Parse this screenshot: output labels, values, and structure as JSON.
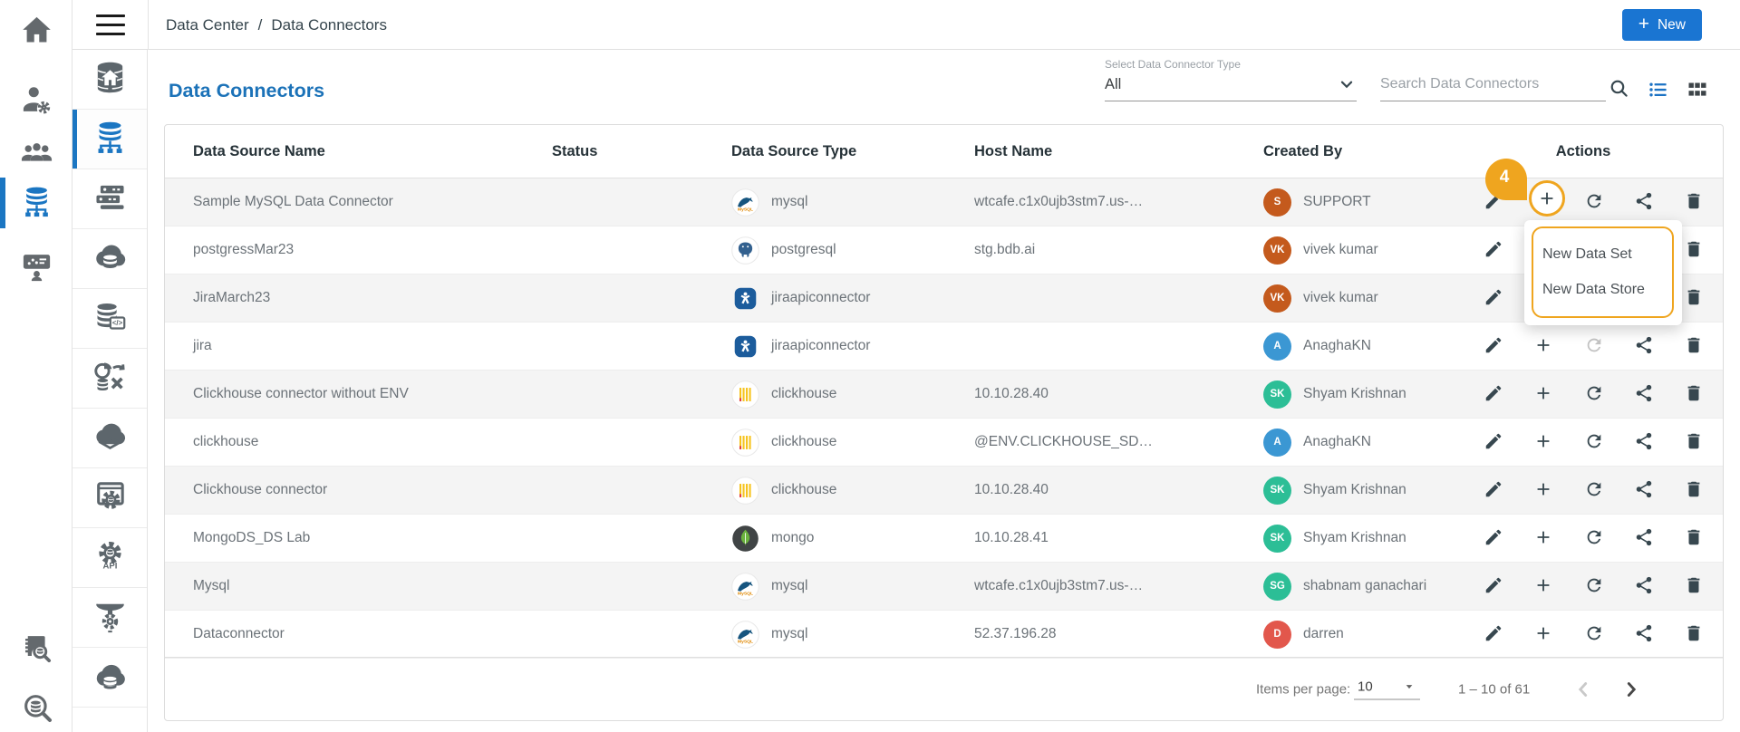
{
  "topbar": {
    "breadcrumb": [
      "Data Center",
      "Data Connectors"
    ],
    "breadcrumb_separator": "/",
    "new_button_label": "New",
    "new_button_plus": "+"
  },
  "page": {
    "title": "Data Connectors"
  },
  "filters": {
    "type_label": "Select Data Connector Type",
    "type_value": "All",
    "search_placeholder": "Search Data Connectors",
    "view_icons": [
      "search-icon",
      "list-view-icon",
      "grid-view-icon"
    ],
    "active_view": "list"
  },
  "sidebar_primary": {
    "items": [
      {
        "icon": "home-icon",
        "active": false
      },
      {
        "icon": "user-settings-icon",
        "active": false
      },
      {
        "icon": "user-groups-icon",
        "active": false
      },
      {
        "icon": "database-network-icon",
        "active": true
      },
      {
        "icon": "dashboard-user-icon",
        "active": false
      },
      {
        "icon": "catalog-search-icon",
        "active": false
      },
      {
        "icon": "database-search-icon",
        "active": false
      }
    ]
  },
  "sidebar_secondary": {
    "items": [
      {
        "icon": "database-home-icon",
        "active": false
      },
      {
        "icon": "database-network-icon",
        "active": true
      },
      {
        "icon": "server-rack-icon",
        "active": false
      },
      {
        "icon": "cloud-database-icon",
        "active": false
      },
      {
        "icon": "database-code-icon",
        "active": false
      },
      {
        "icon": "data-sync-icon",
        "active": false
      },
      {
        "icon": "cloud-layer-icon",
        "active": false
      },
      {
        "icon": "gear-database-window-icon",
        "active": false
      },
      {
        "icon": "api-gear-icon",
        "active": false
      },
      {
        "icon": "funnel-gear-icon",
        "active": false
      },
      {
        "icon": "cloud-database-stack-icon",
        "active": false
      }
    ]
  },
  "table": {
    "columns": [
      "Data Source Name",
      "Status",
      "Data Source Type",
      "Host Name",
      "Created By",
      "Actions"
    ],
    "action_icons": [
      "edit-icon",
      "add-icon",
      "refresh-icon",
      "share-icon",
      "delete-icon"
    ],
    "rows": [
      {
        "name": "Sample MySQL Data Connector",
        "status": "",
        "type": "mysql",
        "type_icon": "mysql-icon",
        "host": "wtcafe.c1x0ujb3stm7.us-…",
        "creator": {
          "initials": "S",
          "name": "SUPPORT",
          "color": "#c45a1d"
        },
        "refresh_disabled": false,
        "annotated": true
      },
      {
        "name": "postgressMar23",
        "status": "",
        "type": "postgresql",
        "type_icon": "postgresql-icon",
        "host": "stg.bdb.ai",
        "creator": {
          "initials": "VK",
          "name": "vivek kumar",
          "color": "#c45a1d"
        },
        "refresh_disabled": false,
        "annotated": false
      },
      {
        "name": "JiraMarch23",
        "status": "",
        "type": "jiraapiconnector",
        "type_icon": "jira-icon",
        "host": "",
        "creator": {
          "initials": "VK",
          "name": "vivek kumar",
          "color": "#c45a1d"
        },
        "refresh_disabled": false,
        "annotated": false
      },
      {
        "name": "jira",
        "status": "",
        "type": "jiraapiconnector",
        "type_icon": "jira-icon",
        "host": "",
        "creator": {
          "initials": "A",
          "name": "AnaghaKN",
          "color": "#3b97d3"
        },
        "refresh_disabled": true,
        "annotated": false
      },
      {
        "name": "Clickhouse connector without ENV",
        "status": "",
        "type": "clickhouse",
        "type_icon": "clickhouse-icon",
        "host": "10.10.28.40",
        "creator": {
          "initials": "SK",
          "name": "Shyam Krishnan",
          "color": "#2cbe96"
        },
        "refresh_disabled": false,
        "annotated": false
      },
      {
        "name": "clickhouse",
        "status": "",
        "type": "clickhouse",
        "type_icon": "clickhouse-icon",
        "host": "@ENV.CLICKHOUSE_SD…",
        "creator": {
          "initials": "A",
          "name": "AnaghaKN",
          "color": "#3b97d3"
        },
        "refresh_disabled": false,
        "annotated": false
      },
      {
        "name": "Clickhouse connector",
        "status": "",
        "type": "clickhouse",
        "type_icon": "clickhouse-icon",
        "host": "10.10.28.40",
        "creator": {
          "initials": "SK",
          "name": "Shyam Krishnan",
          "color": "#2cbe96"
        },
        "refresh_disabled": false,
        "annotated": false
      },
      {
        "name": "MongoDS_DS Lab",
        "status": "",
        "type": "mongo",
        "type_icon": "mongo-icon",
        "host": "10.10.28.41",
        "creator": {
          "initials": "SK",
          "name": "Shyam Krishnan",
          "color": "#2cbe96"
        },
        "refresh_disabled": false,
        "annotated": false
      },
      {
        "name": "Mysql",
        "status": "",
        "type": "mysql",
        "type_icon": "mysql-icon",
        "host": "wtcafe.c1x0ujb3stm7.us-…",
        "creator": {
          "initials": "SG",
          "name": "shabnam ganachari",
          "color": "#2cbe96"
        },
        "refresh_disabled": false,
        "annotated": false
      },
      {
        "name": "Dataconnector",
        "status": "",
        "type": "mysql",
        "type_icon": "mysql-icon",
        "host": "52.37.196.28",
        "creator": {
          "initials": "D",
          "name": "darren",
          "color": "#e2574c"
        },
        "refresh_disabled": false,
        "annotated": false
      }
    ]
  },
  "annotation": {
    "badge": "4",
    "menu": [
      "New Data Set",
      "New Data Store"
    ],
    "color": "#efa51f"
  },
  "pagination": {
    "items_per_page_label": "Items per page:",
    "items_per_page": "10",
    "range": "1 – 10 of 61"
  },
  "colors": {
    "accent_blue": "#1b76c2",
    "button_blue": "#1a75d2",
    "title_blue": "#1b72b8",
    "annotation_amber": "#efa51f",
    "row_alt": "#f4f4f4"
  }
}
